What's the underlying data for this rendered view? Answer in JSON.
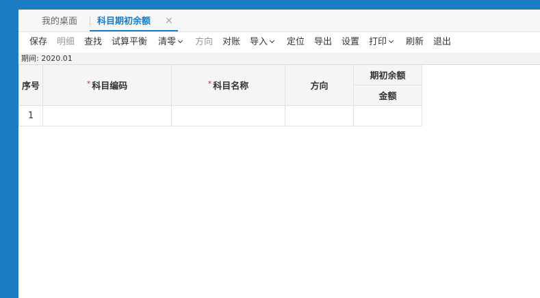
{
  "tabs": {
    "home": "我的桌面",
    "active": "科目期初余额",
    "close_glyph": "✕"
  },
  "toolbar": {
    "save": "保存",
    "detail": "明细",
    "find": "查找",
    "trial_balance": "试算平衡",
    "clear": "清零",
    "direction": "方向",
    "reconcile": "对账",
    "import": "导入",
    "locate": "定位",
    "export": "导出",
    "settings": "设置",
    "print": "打印",
    "refresh": "刷新",
    "exit": "退出"
  },
  "period": {
    "label": "期间:",
    "value": "2020.01"
  },
  "table": {
    "columns": {
      "seq": "序号",
      "code": "科目编码",
      "name": "科目名称",
      "direction": "方向",
      "opening_balance": "期初余额",
      "amount": "金额"
    },
    "required_mark": "*",
    "rows": [
      {
        "seq": "1",
        "code": "",
        "name": "",
        "direction": "",
        "amount": ""
      }
    ]
  }
}
